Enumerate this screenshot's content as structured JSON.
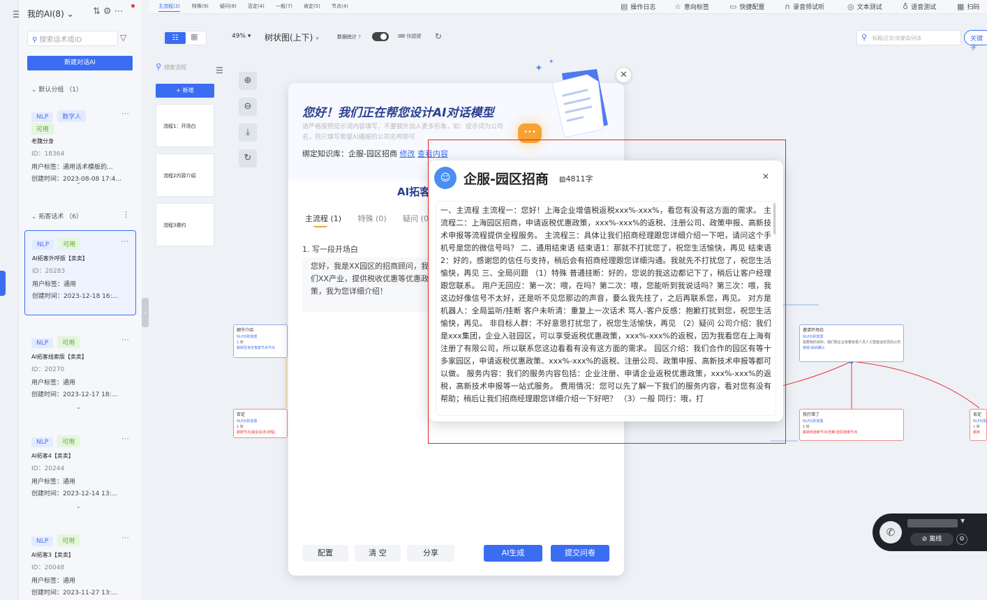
{
  "ai_list": {
    "title": "我的AI(8)",
    "search_placeholder": "搜索话术或ID",
    "new_button": "新建对话AI",
    "group1": "默认分组 （1）",
    "group2": "拓客话术 （6）",
    "cards": [
      {
        "tag1": "NLP",
        "tag2": "数字人",
        "tag3": "可用",
        "name": "老魏分身",
        "id": "ID：18364",
        "labels": "用户标签：通用话术模板的...",
        "created": "创建时间：2023-08-08 17:4..."
      },
      {
        "tag1": "NLP",
        "tag2": "可用",
        "name": "AI拓客外呼版【卖卖】",
        "id": "ID：20283",
        "labels": "用户标签：通用",
        "created": "创建时间：2023-12-18 16:..."
      },
      {
        "tag1": "NLP",
        "tag2": "可用",
        "name": "AI拓客线索版【卖卖】",
        "id": "ID：20270",
        "labels": "用户标签：通用",
        "created": "创建时间：2023-12-17 18:..."
      },
      {
        "tag1": "NLP",
        "tag2": "可用",
        "name": "AI拓客4【卖卖】",
        "id": "ID：20244",
        "labels": "用户标签：通用",
        "created": "创建时间：2023-12-14 13:..."
      },
      {
        "tag1": "NLP",
        "tag2": "可用",
        "name": "AI拓客3【卖卖】",
        "id": "ID：20048",
        "labels": "用户标签：通用",
        "created": "创建时间：2023-11-27 13:..."
      }
    ]
  },
  "tabs": [
    "主流程(3)",
    "特殊(9)",
    "疑问(8)",
    "否定(4)",
    "一般(7)",
    "肯定(5)",
    "节点(4)"
  ],
  "top_tools": [
    "操作日志",
    "意向标签",
    "快捷配置",
    "录音师试听",
    "文本测试",
    "语音测试",
    "扫码"
  ],
  "toolbar": {
    "zoom": "49%",
    "tree_view": "树状图(上下)",
    "stat_label": "数据统计",
    "shortcut": "快捷键",
    "right_search_placeholder": "标题/正文/关键词/问法",
    "keyword_button": "关键字"
  },
  "flow": {
    "search_placeholder": "搜索流程",
    "add_button": "+ 新增",
    "items": [
      "流程1：开场白",
      "流程2内容介绍",
      "流程3邀约"
    ]
  },
  "canvas_nodes": [
    {
      "title": "细节介绍",
      "tag": "NLP识别放置",
      "line1": "1.转",
      "line2": "跳转至肯定答案节点节点"
    },
    {
      "title": "否定",
      "tag": "NLP识别放置",
      "line1": "1.转",
      "line2": "跳转节点/最后请求(流程)"
    },
    {
      "title": "邀请开场白",
      "tag": "NLP识别放置",
      "line1": "需要我的资料，我们想企业有着有很人员人工智能话务员的公司",
      "line2": "接受/采纳确认"
    },
    {
      "title": "我打错了",
      "tag": "NLP识别放置",
      "line1": "1.转",
      "line2": "跳转到挂断节点/挂断/挂机挂断节点"
    },
    {
      "title": "肯定",
      "tag": "NLP识别",
      "line1": "1.转",
      "line2": "跳转"
    }
  ],
  "dialog": {
    "title": "您好！我们正在帮您设计AI对话模型",
    "subtitle": "请严格按照提示词内容填写，不要额外加入更多形象，如：提示词为公司名，则只填写希望AI播报的公司名称即可",
    "kb_label": "绑定知识库：",
    "kb_name": "企服-园区招商",
    "kb_edit": "修改",
    "kb_view": "查看内容",
    "heading": "AI拓客",
    "tabs": [
      "主流程 (1)",
      "特殊 (0)",
      "疑问 (0)"
    ],
    "question_label": "1. 写一段开场白",
    "question_text": "您好，我是XX园区的招商顾问，我们XX产业，提供税收优惠等优惠政策，我为您详细介绍！",
    "buttons": {
      "config": "配置",
      "clear": "清 空",
      "share": "分享",
      "ai_generate": "AI生成",
      "submit": "提交问卷"
    }
  },
  "kb_popup": {
    "title": "企服-园区招商",
    "count": "4811字",
    "content": "一、主流程 主流程一：您好！上海企业增值税返税xxx%-xxx%，看您有没有这方面的需求。 主流程二：上海园区招商，申请返税优惠政策，xxx%-xxx%的返税、注册公司、政策申报、高新技术申报等流程提供全程服务。 主流程三：具体让我们招商经理跟您详细介绍一下吧，请问这个手机号是您的微信号吗？ 二、通用结束语 结束语1：那就不打扰您了，祝您生活愉快，再见 结束语2：好的，感谢您的信任与支持，稍后会有招商经理跟您详细沟通。我就先不打扰您了，祝您生活愉快，再见 三、全局问题 （1）特殊 普通挂断：好的，您说的我这边都记下了，稍后让客户经理跟您联系。 用户无回应：第一次：喂，在吗？第二次：喂，您能听到我说话吗？第三次：喂，我这边好像信号不太好，还是听不见您那边的声音，要么我先挂了，之后再联系您，再见。 对方是机器人：全局监听/挂断 客户未听清：重复上一次话术 骂人-客户反感：抱歉打扰到您，祝您生活愉快，再见。 非目标人群：不好意思打扰您了，祝您生活愉快，再见 （2）疑问 公司介绍：我们是xxx集团，企业入驻园区，可以享受返税优惠政策，xxx%-xxx%的返税，因为我看您在上海有注册了有限公司，所以联系您这边看看有没有这方面的需求。 园区介绍：我们合作的园区有等十多家园区，申请返税优惠政策、xxx%-xxx%的返税、注册公司、政策申报、高新技术申报等都可以做。 服务内容：我们的服务内容包括：企业注册、申请企业返税优惠政策，xxx%-xxx%的返税，高新技术申报等一站式服务。 费用情况：您可以先了解一下我们的服务内容，看对您有没有帮助；稍后让我们招商经理跟您详细介绍一下好吧？ （3）一般 同行：哦，打"
  },
  "call_widget": {
    "offline": "离线"
  },
  "colors": {
    "accent": "#3b6df2",
    "highlight_frame": "#e0241b"
  }
}
